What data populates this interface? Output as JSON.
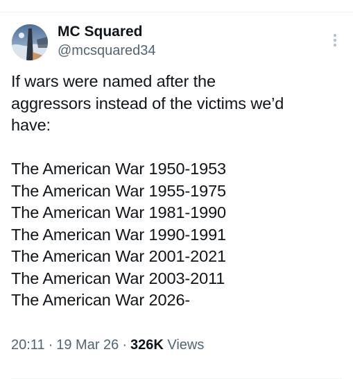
{
  "author": {
    "display_name": "MC Squared",
    "handle": "@mcsquared34",
    "avatar_icon": "profile-photo"
  },
  "menu": {
    "icon": "more-vertical-icon"
  },
  "tweet": {
    "intro_lines": [
      "If wars were named after the",
      "aggressors instead of the victims we’d",
      "have:"
    ],
    "wars": [
      "The American War 1950-1953",
      "The American War 1955-1975",
      "The American War 1981-1990",
      "The American War 1990-1991",
      "The American War 2001-2021",
      "The American War 2003-2011",
      "The American War 2026-"
    ]
  },
  "meta": {
    "time": "20:11",
    "date": "19 Mar 26",
    "separator": "·",
    "views_count": "326K",
    "views_label": "Views"
  },
  "colors": {
    "text": "#0f1419",
    "secondary": "#536471",
    "divider": "#eff3f4"
  }
}
